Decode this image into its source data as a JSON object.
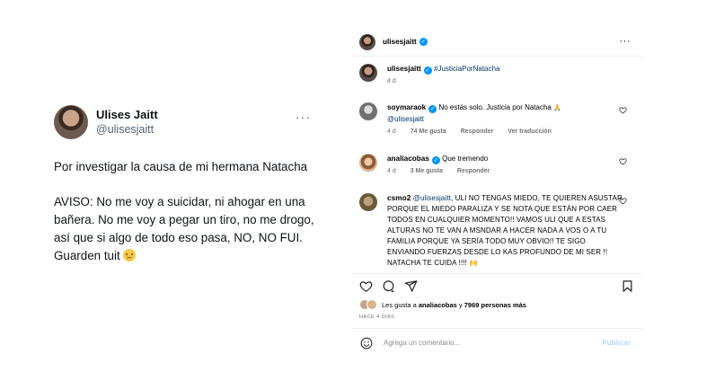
{
  "tweet": {
    "name": "Ulises Jaitt",
    "handle": "@ulisesjaitt",
    "more": "···",
    "line1": "Por investigar la causa de mi hermana Natacha",
    "line2": "AVISO: No me voy a suicidar, ni ahogar en una bañera. No me voy a pegar un tiro, no me drogo, así que si algo de todo eso pasa, NO, NO FUI. Guarden tuit"
  },
  "instagram": {
    "author": "ulisesjaitt",
    "menu": "···",
    "comments": [
      {
        "user": "ulisesjaitt",
        "text": "#JusticiaPorNatacha",
        "time": "4 d"
      },
      {
        "user": "soymaraok",
        "text": "No estás solo. Justicia por Natacha",
        "mention": "@ulisesjaitt",
        "time": "4 d",
        "likes": "74 Me gusta",
        "reply": "Responder",
        "translate": "Ver traducción"
      },
      {
        "user": "analiacobas",
        "text": "Que tremendo",
        "time": "4 d",
        "likes": "3 Me gusta",
        "reply": "Responder"
      },
      {
        "user": "csmo2",
        "mention": "@ulisesjaitt",
        "text": ", ULI NO TENGAS MIEDO, TE QUIEREN ASUSTAR PORQUE EL MIEDO PARALIZA Y SE NOTA QUE ESTÁN POR CAER TODOS EN CUALQUIER MOMENTO!! VAMOS ULI QUE A ESTAS ALTURAS NO TE VAN A MSNDAR A HACER NADA A VOS O A TU FAMILIA PORQUE YA SERÍA TODO MUY OBVIO!! TE SIGO ENVIANDO FUERZAS DESDE LO KAS PROFUNDO DE MI SER !! NATACHA TE CUIDA !!!! 🙌"
      }
    ],
    "likes_prefix": "Les gusta a",
    "likes_user": "analiacobas",
    "likes_mid": "y",
    "likes_count": "7969 personas más",
    "date": "HACE 4 DÍAS",
    "comment_placeholder": "Agrega un comentario...",
    "publish": "Publicar"
  }
}
